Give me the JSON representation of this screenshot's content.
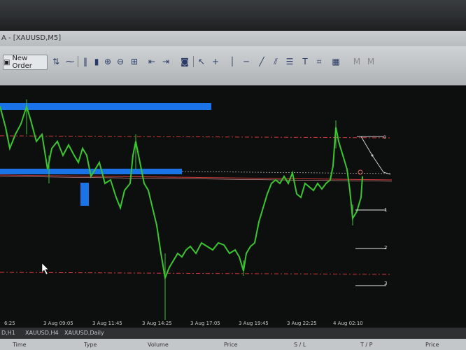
{
  "window": {
    "title": "A - [XAUUSD,M5]"
  },
  "toolbar": {
    "new_order_label": "New Order"
  },
  "chart": {
    "fib_labels": [
      "0",
      "1",
      "2",
      "3"
    ],
    "colors": {
      "candles": "#39c62e",
      "zones": "#1b73e8",
      "level_red": "#d63b3b",
      "level_white": "#e8e8e8"
    }
  },
  "time_axis": [
    "6:25",
    "3 Aug 09:05",
    "3 Aug 11:45",
    "3 Aug 14:25",
    "3 Aug 17:05",
    "3 Aug 19:45",
    "3 Aug 22:25",
    "4 Aug 02:10"
  ],
  "tabs": [
    "D,H1",
    "XAUUSD,H4",
    "XAUUSD,Daily"
  ],
  "trade_columns": [
    "Time",
    "Type",
    "Volume",
    "Price",
    "S / L",
    "T / P",
    "Price"
  ]
}
